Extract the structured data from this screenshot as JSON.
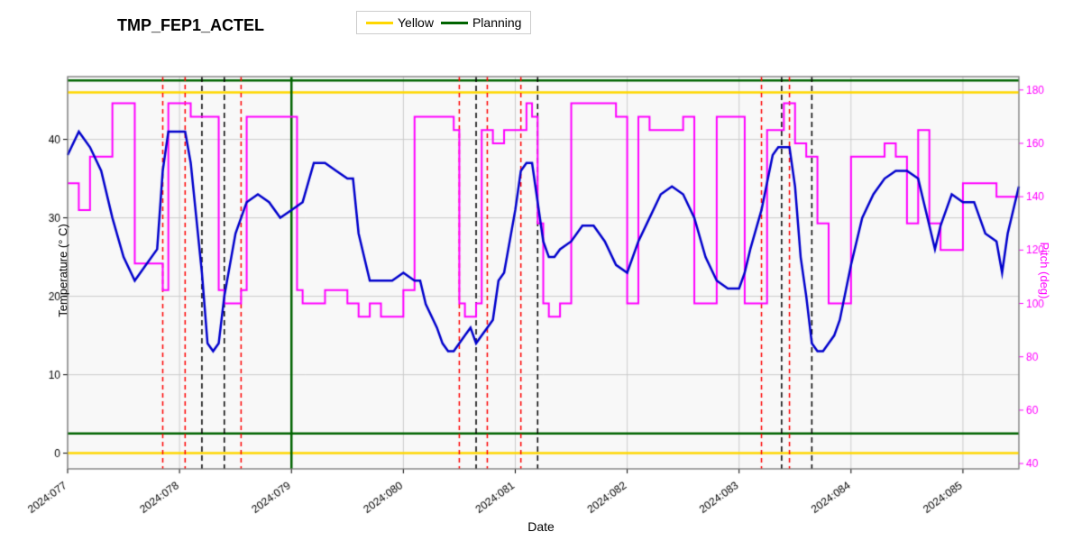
{
  "title": "TMP_FEP1_ACTEL",
  "legend": {
    "yellow_label": "Yellow",
    "planning_label": "Planning"
  },
  "axes": {
    "x_label": "Date",
    "y_left_label": "Temperature (° C)",
    "y_right_label": "Pitch (deg)",
    "x_ticks": [
      "2024:077",
      "2024:078",
      "2024:079",
      "2024:080",
      "2024:081",
      "2024:082",
      "2024:083",
      "2024:084",
      "2024:085"
    ],
    "y_left_ticks": [
      0,
      10,
      20,
      30,
      40
    ],
    "y_right_ticks": [
      40,
      60,
      80,
      100,
      120,
      140,
      160,
      180
    ]
  },
  "colors": {
    "yellow_line": "#FFD700",
    "planning_line": "#006400",
    "blue_line": "#0000CC",
    "magenta_line": "#FF00FF",
    "red_dashed": "#FF0000",
    "black_dashed": "#000000"
  }
}
